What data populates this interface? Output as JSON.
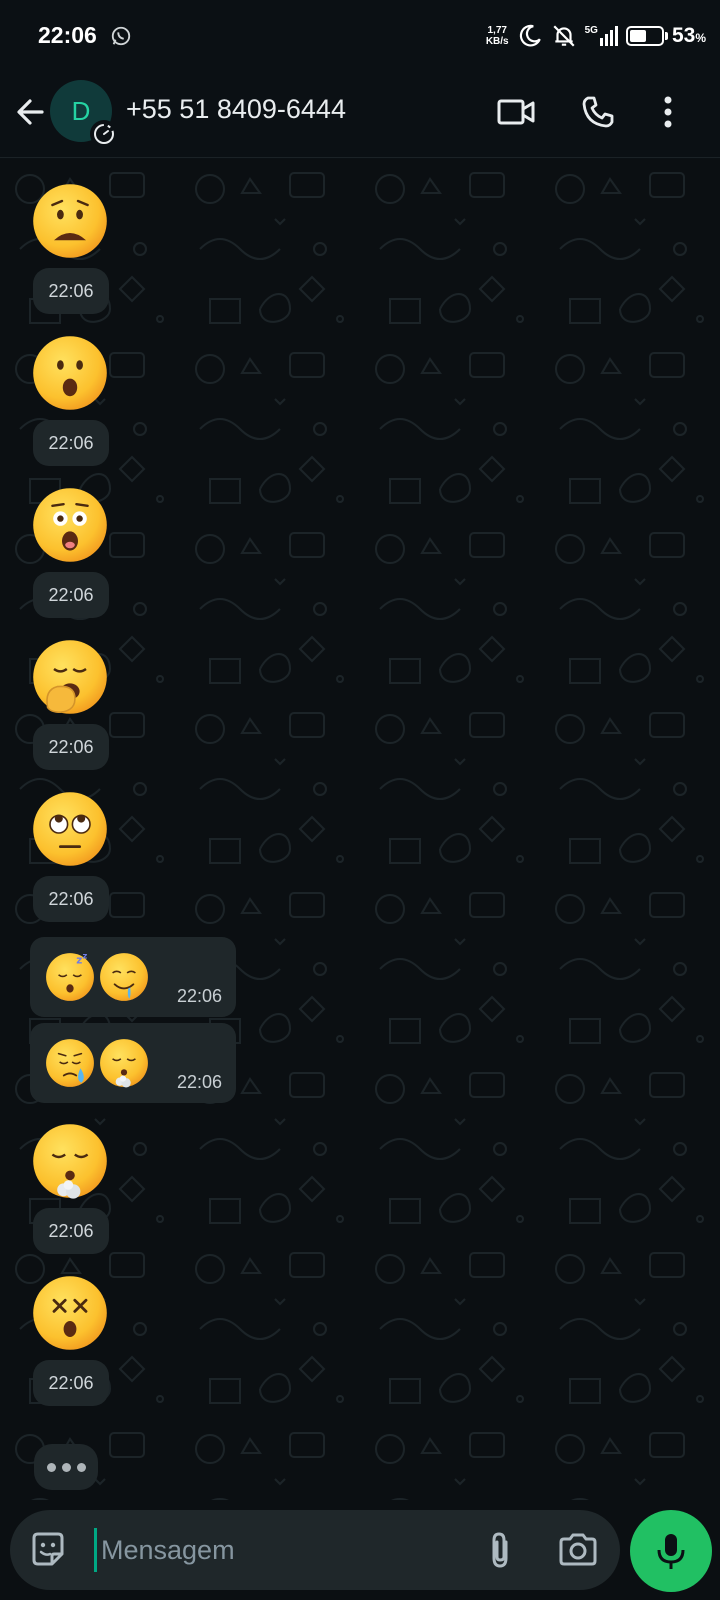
{
  "status_bar": {
    "time": "22:06",
    "net_speed_value": "1,77",
    "net_speed_unit": "KB/s",
    "network": "5G",
    "battery_percent": "53",
    "battery_symbol": "%",
    "battery_level": 0.53
  },
  "header": {
    "avatar_letter": "D",
    "contact_name": "+55 51 8409-6444"
  },
  "messages": [
    {
      "type": "emoji",
      "emoji": "anguished-face",
      "time": "22:06"
    },
    {
      "type": "emoji",
      "emoji": "face-with-open-mouth",
      "time": "22:06"
    },
    {
      "type": "emoji",
      "emoji": "astonished-face",
      "time": "22:06"
    },
    {
      "type": "emoji",
      "emoji": "yawning-face",
      "time": "22:06"
    },
    {
      "type": "emoji",
      "emoji": "face-with-rolling-eyes",
      "time": "22:06"
    },
    {
      "type": "bubble",
      "emojis": [
        "sleeping-face",
        "drooling-face"
      ],
      "time": "22:06"
    },
    {
      "type": "bubble",
      "emojis": [
        "sad-but-relieved-face",
        "face-exhaling"
      ],
      "time": "22:06"
    },
    {
      "type": "emoji",
      "emoji": "face-exhaling",
      "time": "22:06"
    },
    {
      "type": "emoji",
      "emoji": "face-with-crossed-out-eyes",
      "time": "22:06"
    }
  ],
  "composer": {
    "placeholder": "Mensagem"
  },
  "colors": {
    "background": "#0b1014",
    "bubble": "#1f272a",
    "accent": "#21c063",
    "avatar_text": "#25d3a3"
  }
}
